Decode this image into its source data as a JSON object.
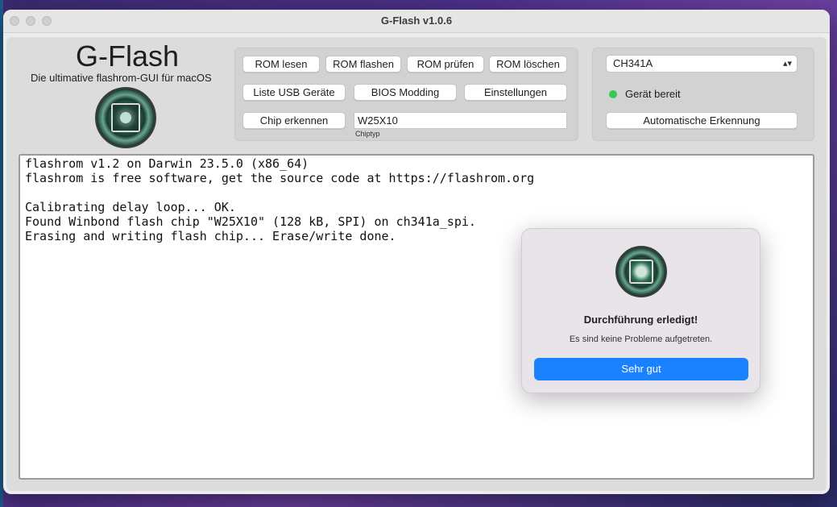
{
  "window": {
    "title": "G-Flash v1.0.6"
  },
  "app": {
    "name": "G-Flash",
    "tagline": "Die ultimative flashrom-GUI für macOS"
  },
  "actions": {
    "rom_read": "ROM lesen",
    "rom_flash": "ROM flashen",
    "rom_verify": "ROM prüfen",
    "rom_erase": "ROM löschen",
    "usb_list": "Liste USB Geräte",
    "bios_modding": "BIOS Modding",
    "settings": "Einstellungen",
    "chip_detect": "Chip erkennen"
  },
  "chip": {
    "value": "W25X10",
    "caption": "Chiptyp"
  },
  "programmer": {
    "selected": "CH341A",
    "status": "Gerät bereit",
    "status_color": "#34c759",
    "auto_detect": "Automatische Erkennung"
  },
  "console": {
    "lines": [
      "flashrom v1.2 on Darwin 23.5.0 (x86_64)",
      "flashrom is free software, get the source code at https://flashrom.org",
      "",
      "Calibrating delay loop... OK.",
      "Found Winbond flash chip \"W25X10\" (128 kB, SPI) on ch341a_spi.",
      "Erasing and writing flash chip... Erase/write done."
    ]
  },
  "dialog": {
    "title": "Durchführung erledigt!",
    "message": "Es sind keine Probleme aufgetreten.",
    "ok_label": "Sehr gut",
    "accent": "#1a82ff"
  },
  "icons": {
    "app_logo": "chip-logo-icon",
    "select_chevron": "chevron-updown-icon"
  }
}
